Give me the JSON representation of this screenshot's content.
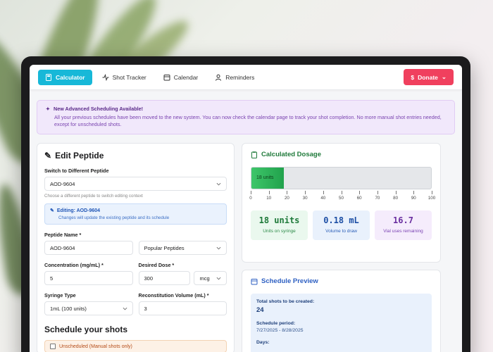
{
  "nav": {
    "items": [
      {
        "label": "Calculator",
        "icon": "calculator-icon",
        "active": true
      },
      {
        "label": "Shot Tracker",
        "icon": "activity-icon",
        "active": false
      },
      {
        "label": "Calendar",
        "icon": "calendar-icon",
        "active": false
      },
      {
        "label": "Reminders",
        "icon": "user-icon",
        "active": false
      }
    ],
    "donate_label": "Donate"
  },
  "banner": {
    "title": "New Advanced Scheduling Available!",
    "body": "All your previous schedules have been moved to the new system. You can now check the calendar page to track your shot completion. No more manual shot entries needed, except for unscheduled shots."
  },
  "edit": {
    "title": "Edit Peptide",
    "switch_label": "Switch to Different Peptide",
    "switch_value": "AOD-9604",
    "switch_hint": "Choose a different peptide to switch editing context",
    "editing_title": "Editing: AOD-9604",
    "editing_sub": "Changes will update the existing peptide and its schedule",
    "name_label": "Peptide Name *",
    "name_value": "AOD-9604",
    "popular_label": "Popular Peptides",
    "conc_label": "Concentration (mg/mL) *",
    "conc_value": "5",
    "dose_label": "Desired Dose *",
    "dose_value": "300",
    "dose_unit": "mcg",
    "syringe_label": "Syringe Type",
    "syringe_value": "1mL (100 units)",
    "recon_label": "Reconstitution Volume (mL) *",
    "recon_value": "3",
    "schedule_title": "Schedule your shots",
    "unscheduled_label": "Unscheduled (Manual shots only)"
  },
  "dosage": {
    "title": "Calculated Dosage",
    "fill_label": "18 units",
    "fill_fraction": 0.18,
    "ticks": [
      "0",
      "10",
      "20",
      "30",
      "40",
      "50",
      "60",
      "70",
      "80",
      "90",
      "100"
    ],
    "stats": [
      {
        "value": "18 units",
        "label": "Units on syringe"
      },
      {
        "value": "0.18 mL",
        "label": "Volume to draw"
      },
      {
        "value": "16.7",
        "label": "Vial uses remaining"
      }
    ]
  },
  "schedule": {
    "title": "Schedule Preview",
    "total_label": "Total shots to be created:",
    "total_value": "24",
    "period_label": "Schedule period:",
    "period_value": "7/27/2025 - 8/28/2025",
    "days_label": "Days:"
  }
}
